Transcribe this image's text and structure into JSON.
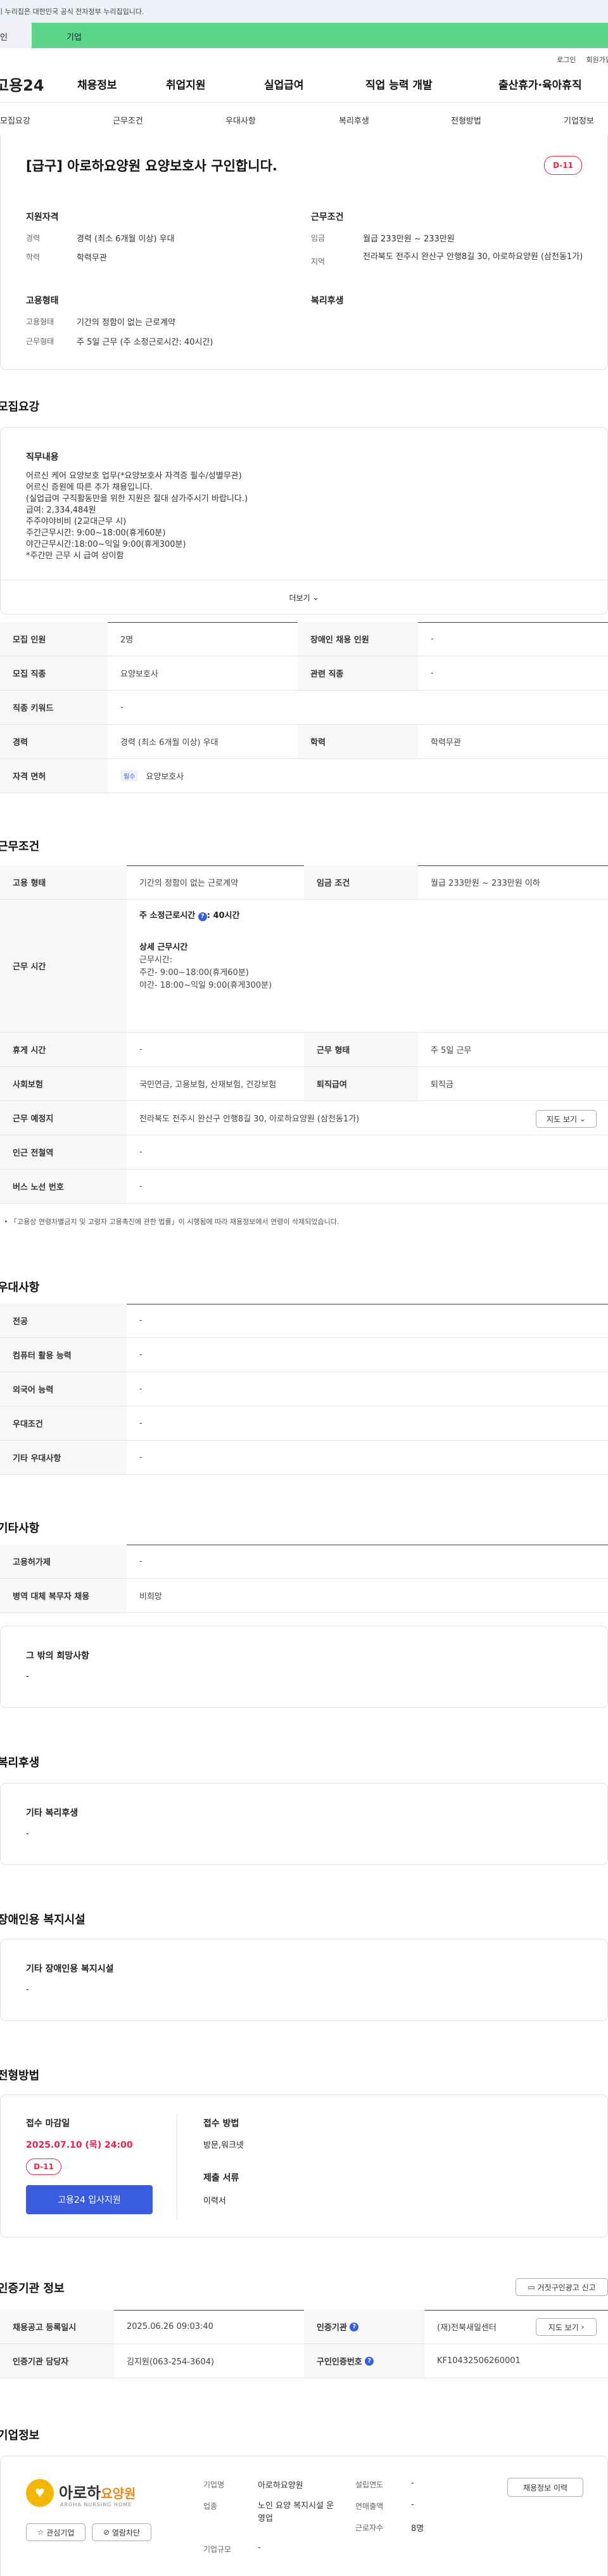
{
  "gov_banner": "이 누리집은 대한민국 공식 전자정부 누리집입니다.",
  "top_tabs": {
    "personal": "개인",
    "company": "기업"
  },
  "util": {
    "login": "로그인",
    "join": "회원가입"
  },
  "gnb": {
    "logo": "고용24",
    "menu": [
      "채용정보",
      "취업지원",
      "실업급여",
      "직업 능력 개발",
      "출산휴가·육아휴직"
    ]
  },
  "anchor_tabs": [
    "모집요강",
    "근무조건",
    "우대사항",
    "복리후생",
    "전형방법",
    "기업정보"
  ],
  "job_title": "[급구] 아로하요양원 요양보호사 구인합니다.",
  "dday": "D-11",
  "summary": {
    "qual_title": "지원자격",
    "career_label": "경력",
    "career_value": "경력 (최소 6개월 이상) 우대",
    "edu_label": "학력",
    "edu_value": "학력무관",
    "cond_title": "근무조건",
    "wage_label": "임금",
    "wage_value": "월급 233만원 ~ 233만원",
    "loc_label": "지역",
    "loc_value": "전라북도 전주시 완산구 안행8길 30, 아로하요양원 (삼천동1가)",
    "emp_title": "고용형태",
    "emp_type_label": "고용형태",
    "emp_type_value": "기간의 정함이 없는 근로계약",
    "work_type_label": "근무형태",
    "work_type_value": "주 5일 근무 (주 소정근로시간: 40시간)",
    "welfare_title": "복리후생"
  },
  "recruit": {
    "title": "모집요강",
    "content_title": "직무내용",
    "content_lines": [
      "어르신 케어 요양보호 업무(*요양보호사 자격증 필수/성별무관)",
      "어르신 증원에 따른 추가 채용입니다.",
      "(실업급여 구직활동만을 위한 지원은 절대 삼가주시기 바랍니다.)",
      "급여: 2,334,484원",
      "주주야야비비 (2교대근무 시)",
      "주간근무시간: 9:00~18:00(휴게60분)",
      "야간근무시간:18:00~익일 9:00(휴게300분)",
      "*주간만 근무 시 급여 상이함"
    ],
    "more": "더보기",
    "rows": [
      {
        "k1": "모집 인원",
        "v1": "2명",
        "k2": "장애인 채용 인원",
        "v2": "-"
      },
      {
        "k1": "모집 직종",
        "v1": "요양보호사",
        "k2": "관련 직종",
        "v2": "-"
      },
      {
        "k1": "직종 키워드",
        "v1": "-"
      },
      {
        "k1": "경력",
        "v1": "경력 (최소 6개월 이상) 우대",
        "k2": "학력",
        "v2": "학력무관"
      },
      {
        "k1": "자격 면허",
        "tag": "필수",
        "v1": "요양보호사"
      }
    ]
  },
  "work": {
    "title": "근무조건",
    "emp_type_k": "고용 형태",
    "emp_type_v": "기간의 정함이 없는 근로계약",
    "wage_k": "임금 조건",
    "wage_v": "월급 233만원 ~ 233만원 이하",
    "hours_k": "근무 시간",
    "hours_main": "주 소정근로시간",
    "hours_main_v": ": 40시간",
    "hours_detail_title": "상세 근무시간",
    "hours_lines": [
      "근무시간:",
      "주간- 9:00~18:00(휴게60분)",
      "야간- 18:00~익일 9:00(휴게300분)"
    ],
    "rest_k": "휴게 시간",
    "rest_v": "-",
    "shape_k": "근무 형태",
    "shape_v": "주 5일 근무",
    "ins_k": "사회보험",
    "ins_v": "국민연금, 고용보험, 산재보험, 건강보험",
    "sev_k": "퇴직급여",
    "sev_v": "퇴직금",
    "place_k": "근무 예정지",
    "place_v": "전라북도 전주시 완산구 안행8길 30, 아로하요양원 (삼천동1가)",
    "map_btn": "지도 보기",
    "subway_k": "인근 전철역",
    "subway_v": "-",
    "bus_k": "버스 노선 번호",
    "bus_v": "-",
    "note": "「고용상 연령차별금지 및 고령자 고용촉진에 관한 법률」이 시행됨에 따라 채용정보에서 연령이 삭제되었습니다."
  },
  "pref": {
    "title": "우대사항",
    "rows": [
      {
        "k": "전공",
        "v": "-"
      },
      {
        "k": "컴퓨터 활용 능력",
        "v": "-"
      },
      {
        "k": "외국어 능력",
        "v": "-"
      },
      {
        "k": "우대조건",
        "v": "-"
      },
      {
        "k": "기타 우대사항",
        "v": "-"
      }
    ]
  },
  "etc": {
    "title": "기타사항",
    "rows": [
      {
        "k": "고용허가제",
        "v": "-"
      },
      {
        "k": "병역 대체 복무자 채용",
        "v": "비희망"
      }
    ],
    "other_title": "그 밖의 희망사항",
    "other_v": "-"
  },
  "welfare": {
    "title": "복리후생",
    "box_title": "기타 복리후생",
    "box_v": "-"
  },
  "disability": {
    "title": "장애인용 복지시설",
    "box_title": "기타 장애인용 복지시설",
    "box_v": "-"
  },
  "selection": {
    "title": "전형방법",
    "deadline_title": "접수 마감일",
    "deadline": "2025.07.10 (목) 24:00",
    "dday": "D-11",
    "apply_btn": "고용24 입사지원",
    "method_title": "접수 방법",
    "method_v": "방문,워크넷",
    "doc_title": "제출 서류",
    "doc_v": "이력서"
  },
  "cert": {
    "title": "인증기관 정보",
    "report_btn": "거짓구인광고 신고",
    "reg_k": "채용공고 등록일시",
    "reg_v": "2025.06.26 09:03:40",
    "org_k": "인증기관",
    "org_v": "(재)전북새일센터",
    "map_btn": "지도 보기",
    "mgr_k": "인증기관 담당자",
    "mgr_v": "김지원(063-254-3604)",
    "no_k": "구인인증번호",
    "no_v": "KF10432506260001"
  },
  "company": {
    "title": "기업정보",
    "logo_text": "아로하",
    "logo_sub": "요양원",
    "logo_eng": "AROHA NURSING HOME",
    "fav_btn": "관심기업",
    "block_btn": "열람차단",
    "name_k": "기업명",
    "name_v": "아로하요양원",
    "year_k": "설립연도",
    "year_v": "-",
    "biz_k": "업종",
    "biz_v": "노인 요양 복지시설 운영업",
    "sales_k": "연매출액",
    "sales_v": "-",
    "emp_k": "근로자수",
    "emp_v": "8명",
    "size_k": "기업규모",
    "size_v": "-",
    "history_btn": "채용정보 이력"
  },
  "colors": {
    "accent": "#3a5de0",
    "dday": "#e0224d",
    "green": "#5ed68a"
  }
}
